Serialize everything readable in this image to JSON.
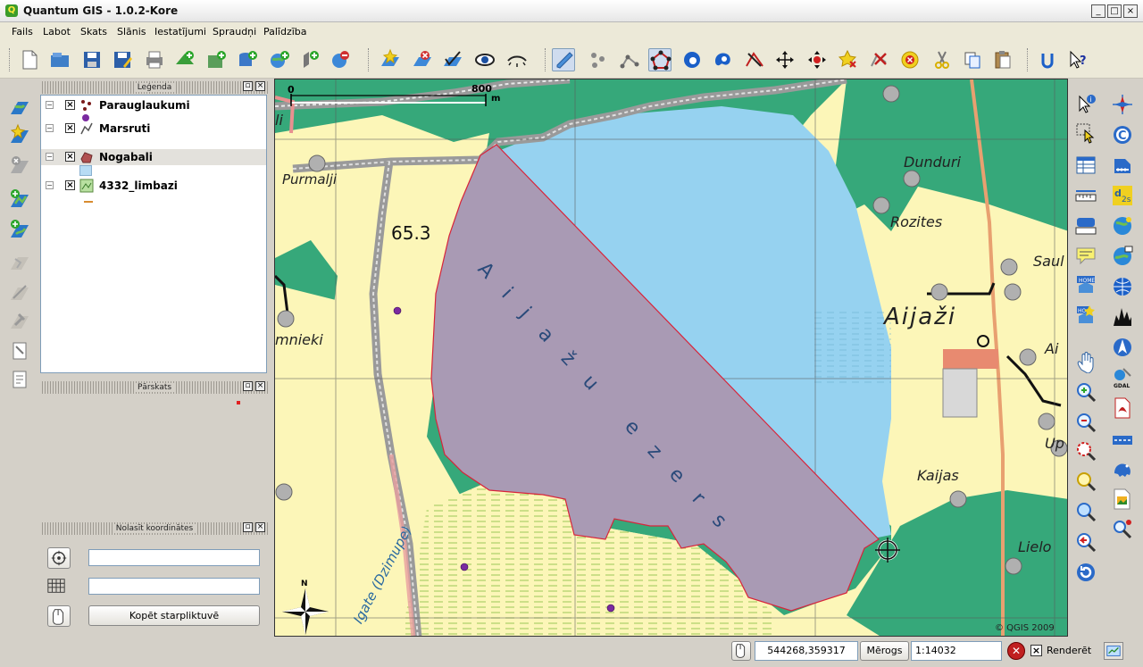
{
  "window": {
    "title": "Quantum GIS - 1.0.2-Kore",
    "controls": [
      "_",
      "□",
      "×"
    ]
  },
  "menu": [
    "Fails",
    "Labot",
    "Skats",
    "Slānis",
    "Iestatījumi",
    "Spraudņi",
    "Palīdzība"
  ],
  "toolbar": {
    "icons": [
      "new-project-icon",
      "open-project-icon",
      "save-project-icon",
      "save-as-icon",
      "print-icon",
      "add-vector-layer-icon",
      "add-raster-layer-icon",
      "add-postgis-layer-icon",
      "add-wms-layer-icon",
      "new-vector-layer-icon",
      "remove-layer-icon",
      "add-to-overview-icon",
      "remove-from-overview-icon",
      "show-all-layers-icon",
      "hide-all-layers-icon",
      "toggle-editing-icon",
      "capture-point-icon",
      "capture-line-icon",
      "capture-polygon-icon",
      "add-ring-icon",
      "add-island-icon",
      "split-features-icon",
      "move-vertex-icon",
      "add-vertex-icon",
      "delete-vertex-icon",
      "move-feature-icon",
      "delete-selected-icon",
      "cut-features-icon",
      "copy-features-icon",
      "paste-features-icon",
      "plugin-manager-icon",
      "whats-this-icon"
    ]
  },
  "legend": {
    "title": "Leģenda",
    "layers": [
      {
        "name": "Parauglaukumi",
        "visible": "×",
        "selected": false
      },
      {
        "name": "Marsruti",
        "visible": "×",
        "selected": false
      },
      {
        "name": "Nogabali",
        "visible": "×",
        "selected": true
      },
      {
        "name": "4332_limbazi",
        "visible": "×",
        "selected": false
      }
    ]
  },
  "overview": {
    "title": "Pārskats"
  },
  "coords": {
    "title": "Nolasīt koordinātes",
    "field1": "",
    "field2": "",
    "copy_button": "Kopēt starpliktuvē"
  },
  "map": {
    "scalebar": {
      "start": "0",
      "end": "800",
      "unit": "m"
    },
    "labels": {
      "purmalji": "Purmalji",
      "elevation": "65.3",
      "dunduri": "Dunduri",
      "rozites": "Rozites",
      "saul": "Saul",
      "aijazi": "Aijaži",
      "ai": "Ai",
      "up": "Up",
      "kaijas": "Kaijas",
      "lielo": "Lielo",
      "mnieki": "mnieki",
      "li": "li",
      "lake": "Aijažu ezers",
      "river": "Igate (Dzimupe)",
      "copyright": "© QGIS 2009",
      "north": "N"
    }
  },
  "statusbar": {
    "coordinates": "544268,359317",
    "scale_label": "Mērogs",
    "scale_value": "1:14032",
    "render_label": "Renderēt",
    "render_checked": "×"
  },
  "colors": {
    "water": "#96d2f0",
    "forest": "#36a87a",
    "field": "#fcf6b8",
    "parcel": "#a99ab4",
    "parcel_edge": "#d8243a",
    "road": "#9a9a9a",
    "point": "#7a2aa0"
  }
}
